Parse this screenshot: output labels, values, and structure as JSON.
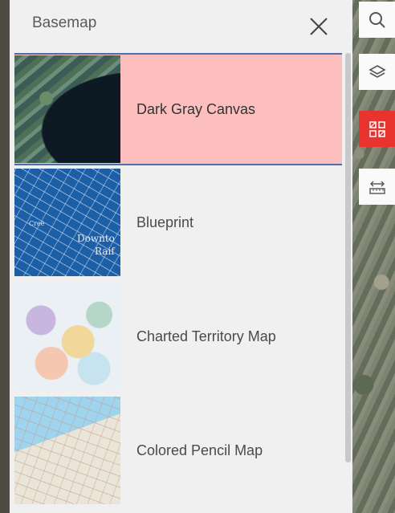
{
  "panel": {
    "title": "Basemap",
    "items": [
      {
        "label": "Dark Gray Canvas",
        "selected": true,
        "thumb": "dark-gray-canvas"
      },
      {
        "label": "Blueprint",
        "selected": false,
        "thumb": "blueprint"
      },
      {
        "label": "Charted Territory Map",
        "selected": false,
        "thumb": "charted-territory"
      },
      {
        "label": "Colored Pencil Map",
        "selected": false,
        "thumb": "colored-pencil"
      }
    ],
    "blueprint_thumb_text": [
      "Downto",
      "Raif",
      "Cree"
    ]
  },
  "toolbar": {
    "tools": [
      "search-icon",
      "layers-icon",
      "qr-select-icon",
      "measure-icon"
    ],
    "active_color": "#e8332f"
  },
  "colors": {
    "selected_bg": "#fdbfbe",
    "selected_border": "#4d6fa8"
  }
}
